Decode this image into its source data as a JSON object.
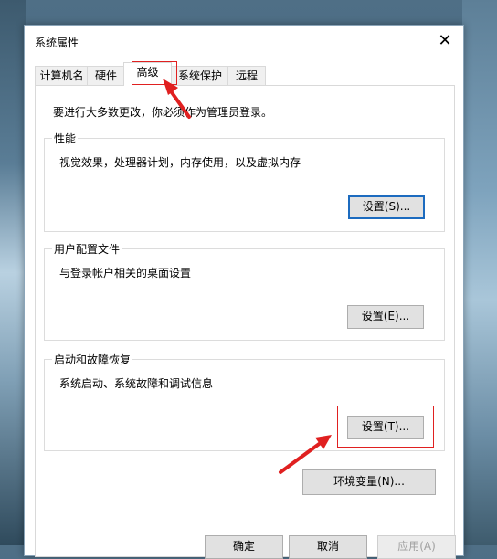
{
  "window": {
    "title": "系统属性",
    "close_label": "✕"
  },
  "tabs": [
    {
      "label": "计算机名"
    },
    {
      "label": "硬件"
    },
    {
      "label": "高级"
    },
    {
      "label": "系统保护"
    },
    {
      "label": "远程"
    }
  ],
  "advanced": {
    "admin_note": "要进行大多数更改，你必须作为管理员登录。",
    "performance": {
      "title": "性能",
      "description": "视觉效果，处理器计划，内存使用，以及虚拟内存",
      "button": "设置(S)..."
    },
    "user_profiles": {
      "title": "用户配置文件",
      "description": "与登录帐户相关的桌面设置",
      "button": "设置(E)..."
    },
    "startup_recovery": {
      "title": "启动和故障恢复",
      "description": "系统启动、系统故障和调试信息",
      "button": "设置(T)..."
    },
    "env_vars_button": "环境变量(N)..."
  },
  "footer": {
    "ok": "确定",
    "cancel": "取消",
    "apply": "应用(A)"
  },
  "colors": {
    "highlight": "#e02020",
    "focus_border": "#1c6bbf"
  }
}
